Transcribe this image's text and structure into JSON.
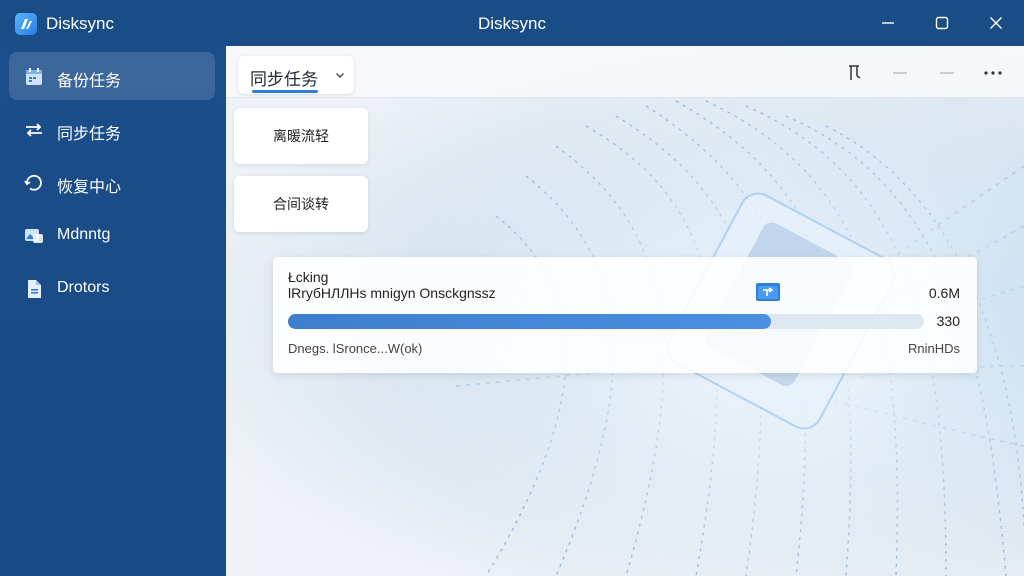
{
  "app": {
    "name": "Disksync",
    "window_title": "Disksync",
    "logo_icon": "app-logo-icon"
  },
  "window_controls": {
    "minimize": "minimize-icon",
    "maximize": "maximize-icon",
    "close": "close-icon"
  },
  "sidebar": {
    "items": [
      {
        "label": "备份任务",
        "icon": "calendar-icon",
        "active": true
      },
      {
        "label": "同步任务",
        "icon": "sync-arrows-icon",
        "active": false
      },
      {
        "label": "恢复中心",
        "icon": "restore-icon",
        "active": false
      },
      {
        "label": "Mdnntg",
        "icon": "image-icon",
        "active": false
      },
      {
        "label": "Drotors",
        "icon": "document-icon",
        "active": false
      }
    ]
  },
  "toolbar": {
    "dropdown_label": "同步任务",
    "icons": [
      "pin-icon",
      "minus-icon",
      "minus-icon",
      "more-icon"
    ]
  },
  "cards": [
    {
      "label": "离暖流轻"
    },
    {
      "label": "合间谈转"
    }
  ],
  "progress": {
    "title": "Łcking",
    "subtitle": "lRryбHЛЛНs mnigyn Onsckgnssz",
    "size": "0.6M",
    "count": "330",
    "fraction": 0.76,
    "status": "Dnegs. lSronce...W(ok)",
    "speed": "RninHDs",
    "file_icon": "folder-transfer-icon"
  },
  "colors": {
    "sidebar_bg": "#1b4e8a",
    "titlebar_bg": "#1a4c86",
    "accent": "#2f7fd6",
    "progress_fill": "#3d7fcf"
  }
}
